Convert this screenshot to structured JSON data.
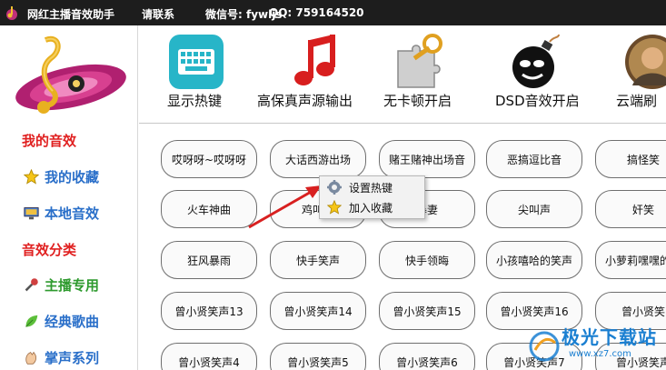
{
  "titlebar": {
    "app_name": "网红主播音效助手",
    "contact": "请联系",
    "wechat": "微信号: fywljs",
    "qq": "QQ:  759164520"
  },
  "sidebar": {
    "heading_my": "我的音效",
    "items_my": [
      {
        "label": "我的收藏",
        "icon": "star-icon"
      },
      {
        "label": "本地音效",
        "icon": "monitor-icon"
      }
    ],
    "heading_category": "音效分类",
    "items_category": [
      {
        "label": "主播专用",
        "icon": "microphone-icon"
      },
      {
        "label": "经典歌曲",
        "icon": "leaf-icon"
      },
      {
        "label": "掌声系列",
        "icon": "clap-icon"
      }
    ]
  },
  "toolbar": {
    "tools": [
      {
        "label": "显示热键",
        "icon": "keyboard-icon"
      },
      {
        "label": "高保真声源输出",
        "icon": "music-note-icon"
      },
      {
        "label": "无卡顿开启",
        "icon": "puzzle-key-icon"
      },
      {
        "label": "DSD音效开启",
        "icon": "bomb-icon"
      },
      {
        "label": "云端刷",
        "icon": "avatar-icon"
      }
    ]
  },
  "sounds": {
    "rows": [
      [
        "哎呀呀~哎呀呀",
        "大话西游出场",
        "赌王赌神出场音",
        "恶搞逗比音",
        "搞怪笑"
      ],
      [
        "火车神曲",
        "鸡叫进",
        "暴妻",
        "尖叫声",
        "奸笑"
      ],
      [
        "狂风暴雨",
        "快手笑声",
        "快手领晦",
        "小孩嘻哈的笑声",
        "小萝莉嘿嘿的笑"
      ],
      [
        "曾小贤笑声13",
        "曾小贤笑声14",
        "曾小贤笑声15",
        "曾小贤笑声16",
        "曾小贤笑"
      ],
      [
        "曾小贤笑声4",
        "曾小贤笑声5",
        "曾小贤笑声6",
        "曾小贤笑声7",
        "曾小贤笑声"
      ]
    ]
  },
  "context_menu": {
    "items": [
      {
        "label": "设置热键",
        "icon": "gear-icon"
      },
      {
        "label": "加入收藏",
        "icon": "star-icon"
      }
    ]
  },
  "watermark": {
    "text": "极光下载站",
    "url": "www.xz7.com"
  },
  "colors": {
    "titlebar_bg": "#1d1d1d",
    "heading_red": "#e02020",
    "item_blue": "#2a6fc9",
    "item_green": "#2e9a2e",
    "arrow_red": "#d82020"
  }
}
